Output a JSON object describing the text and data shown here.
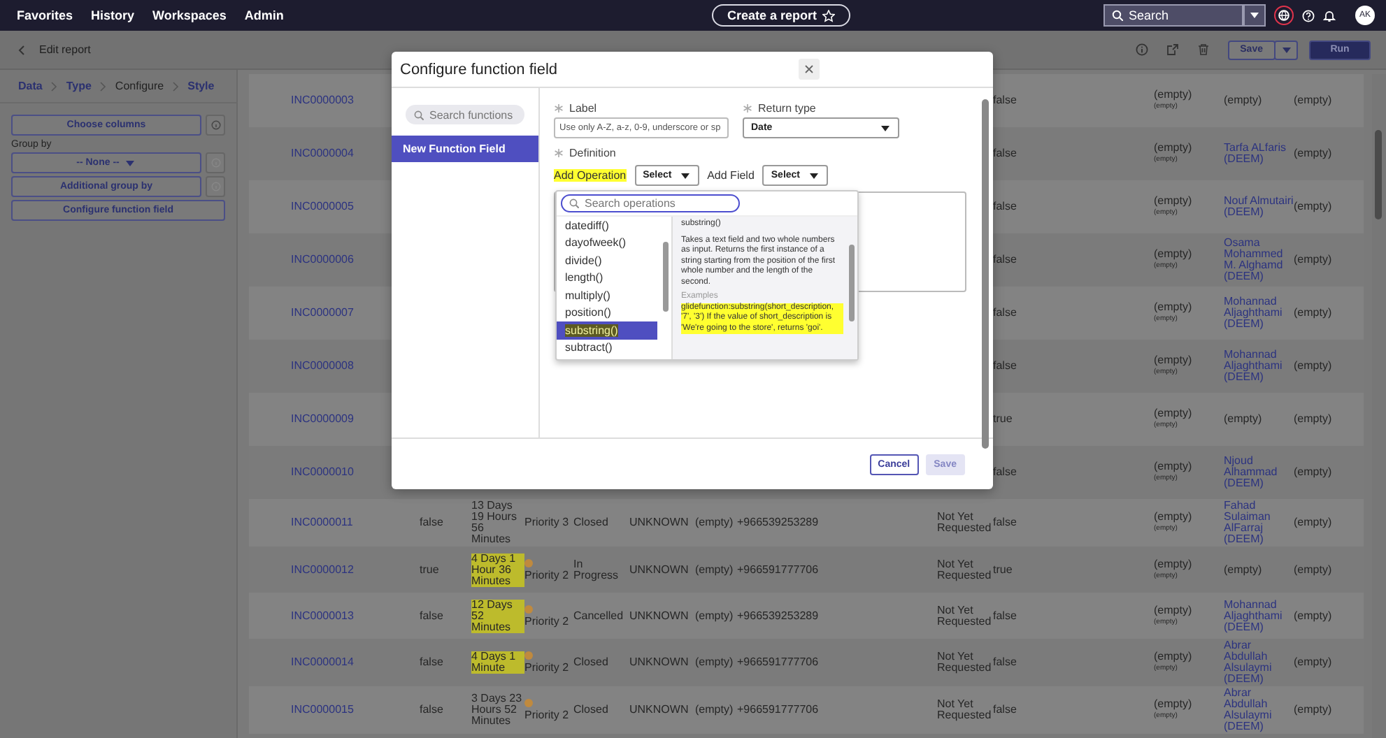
{
  "top_nav": {
    "items": [
      "Favorites",
      "History",
      "Workspaces",
      "Admin"
    ],
    "create_button": "Create a report",
    "search": {
      "placeholder": "Search"
    },
    "avatar": "AK"
  },
  "toolbar": {
    "title": "Edit report",
    "save_button": "Save",
    "run_button": "Run"
  },
  "steps": [
    {
      "label": "Data",
      "selected": false
    },
    {
      "label": "Type",
      "selected": false
    },
    {
      "label": "Configure",
      "selected": true
    },
    {
      "label": "Style",
      "selected": false
    }
  ],
  "sidebar": {
    "choose_columns": "Choose columns",
    "group_by_label": "Group by",
    "group_by_value": "-- None --",
    "additional_group": "Additional group by",
    "configure_function": "Configure function field"
  },
  "table": {
    "rows": [
      {
        "number": "INC0000003",
        "column_10": "false",
        "column_11": "(empty)",
        "column_11_sub": "(empty)",
        "column_12": "(empty)",
        "column_12_link": false,
        "column_13": "(empty)"
      },
      {
        "number": "INC0000004",
        "column_10": "false",
        "column_11": "(empty)",
        "column_11_sub": "(empty)",
        "column_12": "Tarfa ALfaris (DEEM)",
        "column_12_link": true,
        "column_13": "(empty)"
      },
      {
        "number": "INC0000005",
        "column_10": "false",
        "column_11": "(empty)",
        "column_11_sub": "(empty)",
        "column_12": "Nouf Almutairi (DEEM)",
        "column_12_link": true,
        "column_13": "(empty)"
      },
      {
        "number": "INC0000006",
        "column_10": "false",
        "column_11": "(empty)",
        "column_11_sub": "(empty)",
        "column_12": "Osama Mohammed M. Alghamd (DEEM)",
        "column_12_link": true,
        "column_13": "(empty)"
      },
      {
        "number": "INC0000007",
        "column_10": "false",
        "column_11": "(empty)",
        "column_11_sub": "(empty)",
        "column_12": "Mohannad Aljaghthami (DEEM)",
        "column_12_link": true,
        "column_13": "(empty)"
      },
      {
        "number": "INC0000008",
        "column_10": "false",
        "column_11": "(empty)",
        "column_11_sub": "(empty)",
        "column_12": "Mohannad Aljaghthami (DEEM)",
        "column_12_link": true,
        "column_13": "(empty)"
      },
      {
        "number": "INC0000009",
        "column_10": "true",
        "column_11": "(empty)",
        "column_11_sub": "(empty)",
        "column_12": "(empty)",
        "column_12_link": false,
        "column_13": "(empty)"
      },
      {
        "number": "INC0000010",
        "column_10": "false",
        "column_11": "(empty)",
        "column_11_sub": "(empty)",
        "column_12": "Njoud Alhammad (DEEM)",
        "column_12_link": true,
        "column_13": "(empty)"
      },
      {
        "number": "INC0000011",
        "column_2": "false",
        "duration": "13 Days 19 Hours 56 Minutes",
        "duration_highlighted": false,
        "priority": "Priority 3",
        "state": "Closed",
        "column_6": "UNKNOWN",
        "column_7": "(empty)",
        "phone": "+966539253289",
        "column_9": "Not Yet Requested",
        "column_10": "false",
        "column_11": "(empty)",
        "column_11_sub": "(empty)",
        "column_12": "Fahad Sulaiman AlFarraj (DEEM)",
        "column_12_link": true,
        "column_13": "(empty)"
      },
      {
        "number": "INC0000012",
        "column_2": "true",
        "duration": "4 Days 1 Hour 36 Minutes",
        "duration_highlighted": true,
        "priority": "Priority 2",
        "color": "#c08a3e",
        "state": "In Progress",
        "column_6": "UNKNOWN",
        "column_7": "(empty)",
        "phone": "+966591777706",
        "column_9": "Not Yet Requested",
        "column_10": "true",
        "column_11": "(empty)",
        "column_11_sub": "(empty)",
        "column_12": "(empty)",
        "column_12_link": false,
        "column_13": "(empty)"
      },
      {
        "number": "INC0000013",
        "column_2": "false",
        "duration": "12 Days 52 Minutes",
        "duration_highlighted": true,
        "priority": "Priority 2",
        "color": "#c08a3e",
        "state": "Cancelled",
        "column_6": "UNKNOWN",
        "column_7": "(empty)",
        "phone": "+966539253289",
        "column_9": "Not Yet Requested",
        "column_10": "false",
        "column_11": "(empty)",
        "column_11_sub": "(empty)",
        "column_12": "Mohannad Aljaghthami (DEEM)",
        "column_12_link": true,
        "column_13": "(empty)"
      },
      {
        "number": "INC0000014",
        "column_2": "false",
        "duration": "4 Days 1 Minute",
        "duration_highlighted": true,
        "priority": "Priority 2",
        "color": "#c08a3e",
        "state": "Closed",
        "column_6": "UNKNOWN",
        "column_7": "(empty)",
        "phone": "+966591777706",
        "column_9": "Not Yet Requested",
        "column_10": "false",
        "column_11": "(empty)",
        "column_11_sub": "(empty)",
        "column_12": "Abrar Abdullah Alsulaymi (DEEM)",
        "column_12_link": true,
        "column_13": "(empty)"
      },
      {
        "number": "INC0000015",
        "column_2": "false",
        "duration": "3 Days 23 Hours 52 Minutes",
        "duration_highlighted": false,
        "priority": "Priority 2",
        "color": "#c08a3e",
        "state": "Closed",
        "column_6": "UNKNOWN",
        "column_7": "(empty)",
        "phone": "+966591777706",
        "column_9": "Not Yet Requested",
        "column_10": "false",
        "column_11": "(empty)",
        "column_11_sub": "(empty)",
        "column_12": "Abrar Abdullah Alsulaymi (DEEM)",
        "column_12_link": true,
        "column_13": "(empty)"
      }
    ]
  },
  "modal": {
    "title": "Configure function field",
    "search": {
      "placeholder": "Search functions"
    },
    "functions": [
      {
        "label": "New Function Field",
        "selected": true
      }
    ],
    "label_field": {
      "label": "Label",
      "placeholder": "Use only A-Z, a-z, 0-9, underscore or sp"
    },
    "return_type": {
      "label": "Return type",
      "value": "Date"
    },
    "definition_label": "Definition",
    "add_operation": {
      "label": "Add Operation",
      "highlighted": true,
      "value": "Select"
    },
    "add_field": {
      "label": "Add Field",
      "value": "Select"
    },
    "operations_menu": {
      "search": {
        "placeholder": "Search operations"
      },
      "items": [
        {
          "label": "datediff()",
          "selected": false,
          "highlighted": false
        },
        {
          "label": "dayofweek()",
          "selected": false,
          "highlighted": false
        },
        {
          "label": "divide()",
          "selected": false,
          "highlighted": false
        },
        {
          "label": "length()",
          "selected": false,
          "highlighted": false
        },
        {
          "label": "multiply()",
          "selected": false,
          "highlighted": false
        },
        {
          "label": "position()",
          "selected": false,
          "highlighted": false
        },
        {
          "label": "substring()",
          "selected": true,
          "highlighted": true
        },
        {
          "label": "subtract()",
          "selected": false,
          "highlighted": false
        }
      ],
      "detail": {
        "title": "substring()",
        "description": "Takes a text field and two whole numbers as input. Returns the first instance of a string starting from the position of the first whole number and the length of the second.",
        "examples_label": "Examples",
        "example": "glidefunction:substring(short_description, '7', '3') If the value of short_description is 'We're going to the store', returns 'goi'.",
        "highlighted": true
      }
    },
    "buttons": [
      {
        "label": "Cancel",
        "disabled": false
      },
      {
        "label": "Save",
        "disabled": true
      }
    ]
  }
}
